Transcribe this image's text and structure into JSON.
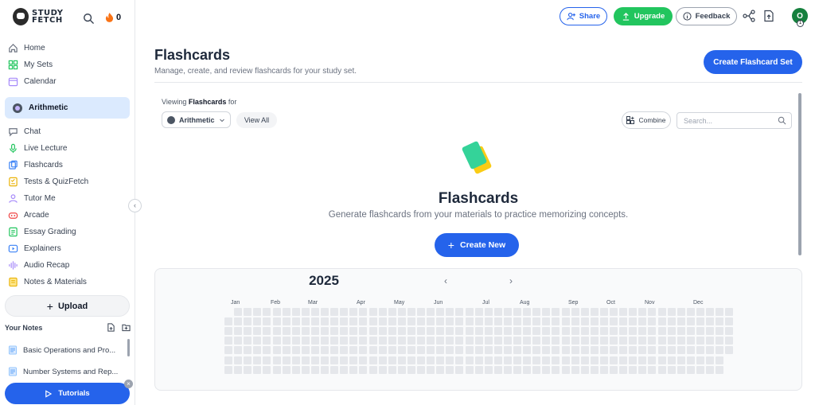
{
  "app": {
    "logo_line1": "STUDY",
    "logo_line2": "FETCH",
    "streak": "0"
  },
  "sidebar": {
    "nav": [
      {
        "label": "Home",
        "icon": "home-icon",
        "color": "#6b7280"
      },
      {
        "label": "My Sets",
        "icon": "sets-icon",
        "color": "#22c55e"
      },
      {
        "label": "Calendar",
        "icon": "calendar-icon",
        "color": "#a78bfa"
      }
    ],
    "current_set": "Arithmetic",
    "tools": [
      {
        "label": "Chat",
        "icon": "chat-icon",
        "color": "#6b7280"
      },
      {
        "label": "Live Lecture",
        "icon": "microphone-icon",
        "color": "#22c55e"
      },
      {
        "label": "Flashcards",
        "icon": "flashcards-icon",
        "color": "#3b82f6"
      },
      {
        "label": "Tests & QuizFetch",
        "icon": "quiz-icon",
        "color": "#eab308"
      },
      {
        "label": "Tutor Me",
        "icon": "tutor-icon",
        "color": "#a78bfa"
      },
      {
        "label": "Arcade",
        "icon": "arcade-icon",
        "color": "#ef4444"
      },
      {
        "label": "Essay Grading",
        "icon": "essay-icon",
        "color": "#22c55e"
      },
      {
        "label": "Explainers",
        "icon": "explainers-icon",
        "color": "#3b82f6"
      },
      {
        "label": "Audio Recap",
        "icon": "audio-icon",
        "color": "#a78bfa"
      },
      {
        "label": "Notes & Materials",
        "icon": "notes-icon",
        "color": "#eab308"
      }
    ],
    "upload_label": "Upload",
    "notes_heading": "Your Notes",
    "notes": [
      {
        "label": "Basic Operations and Pro..."
      },
      {
        "label": "Number Systems and Rep..."
      }
    ],
    "tutorials_label": "Tutorials"
  },
  "header": {
    "share_label": "Share",
    "upgrade_label": "Upgrade",
    "feedback_label": "Feedback",
    "avatar_initial": "O",
    "avatar_badge": "1"
  },
  "main": {
    "title": "Flashcards",
    "subtitle": "Manage, create, and review flashcards for your study set.",
    "create_set_label": "Create Flashcard Set",
    "viewing_prefix": "Viewing",
    "viewing_bold": "Flashcards",
    "viewing_suffix": "for",
    "set_select_value": "Arithmetic",
    "view_all_label": "View All",
    "combine_label": "Combine",
    "search_placeholder": "Search...",
    "empty_title": "Flashcards",
    "empty_subtitle": "Generate flashcards from your materials to practice memorizing concepts.",
    "create_new_label": "Create New"
  },
  "calendar": {
    "year": "2025",
    "months": [
      "Jan",
      "Feb",
      "Mar",
      "Apr",
      "May",
      "Jun",
      "Jul",
      "Aug",
      "Sep",
      "Oct",
      "Nov",
      "Dec"
    ]
  },
  "colors": {
    "accent": "#2563eb",
    "upgrade": "#22c55e",
    "active_bg": "#dbeafe"
  }
}
